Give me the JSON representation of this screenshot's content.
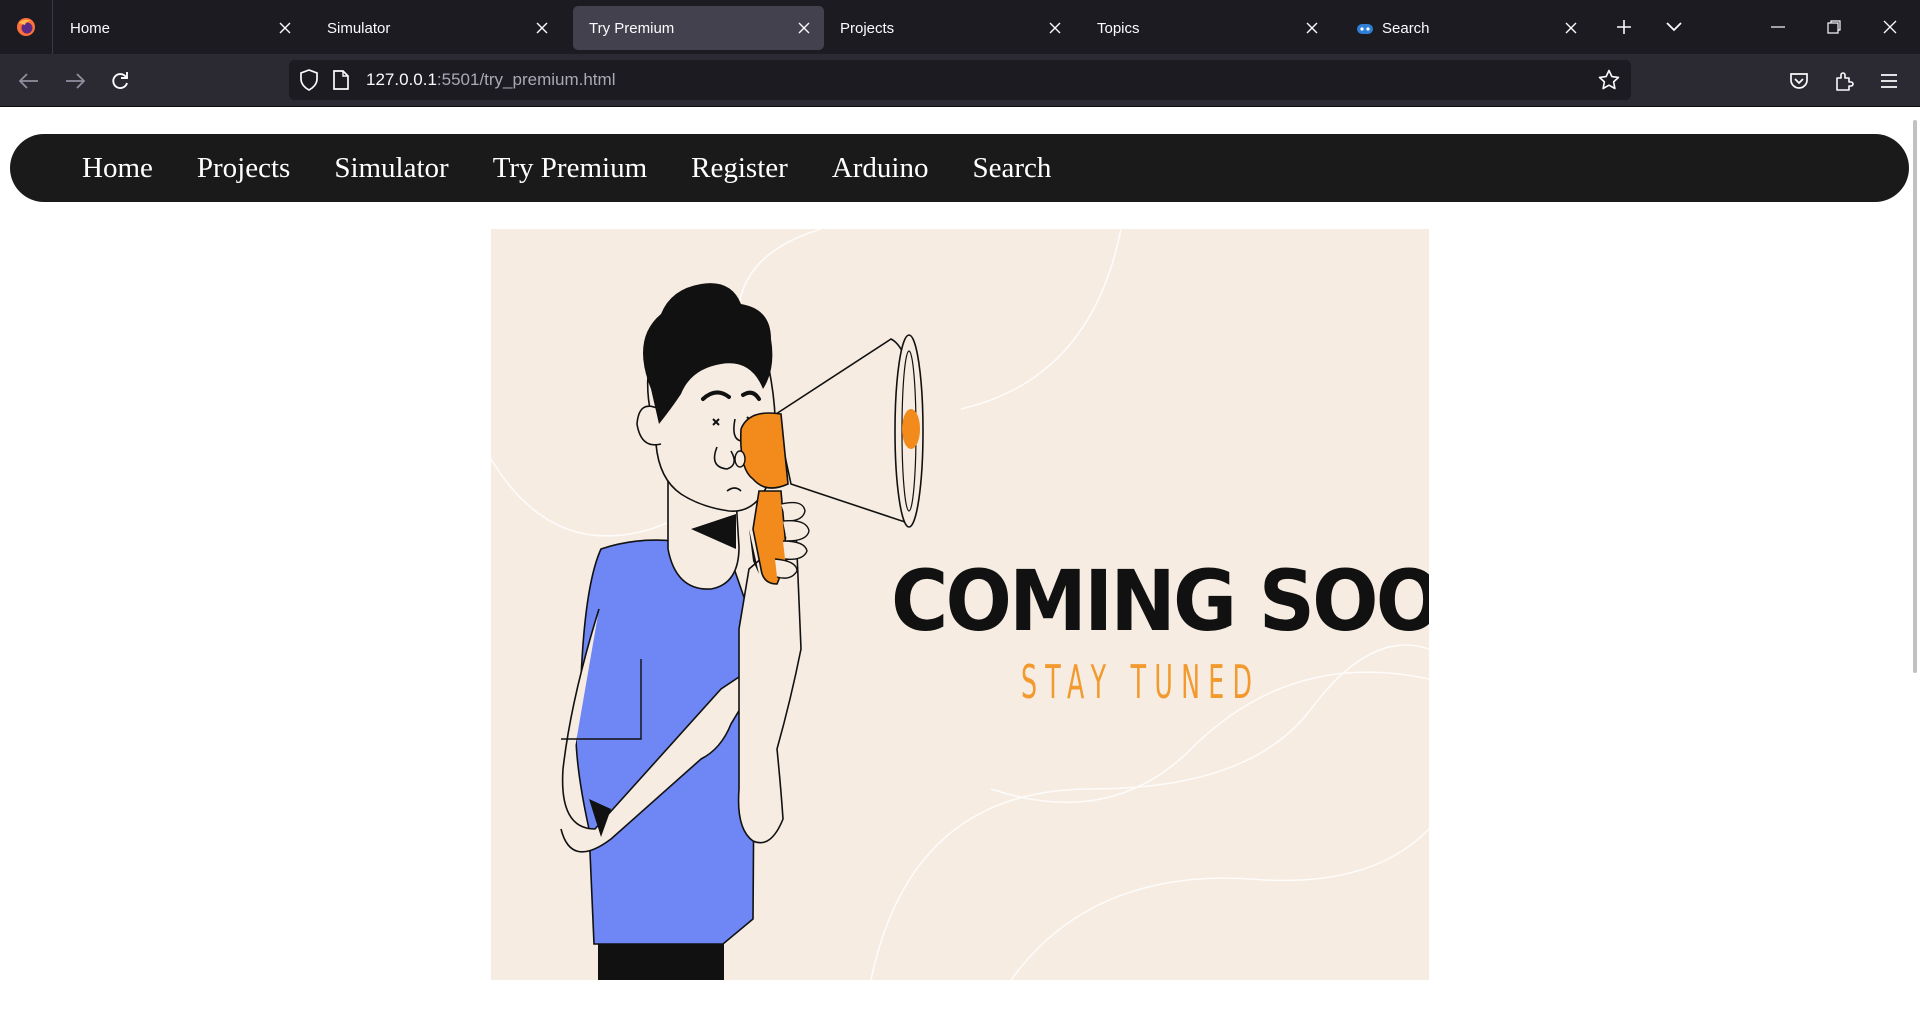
{
  "browser": {
    "tabs": [
      {
        "title": "Home",
        "active": false
      },
      {
        "title": "Simulator",
        "active": false
      },
      {
        "title": "Try Premium",
        "active": true
      },
      {
        "title": "Projects",
        "active": false
      },
      {
        "title": "Topics",
        "active": false
      },
      {
        "title": "Search",
        "active": false
      }
    ],
    "url_host": "127.0.0.1",
    "url_rest": ":5501/try_premium.html"
  },
  "nav": {
    "items": [
      "Home",
      "Projects",
      "Simulator",
      "Try Premium",
      "Register",
      "Arduino",
      "Search"
    ]
  },
  "hero": {
    "headline": "COMING SOON",
    "subline": "STAY TUNED",
    "colors": {
      "background": "#f6ece2",
      "shirt": "#6f86f5",
      "accent": "#f28a1c",
      "ink": "#111111"
    }
  },
  "colors": {
    "tabbar": "#1c1b22",
    "toolbar": "#2b2a33",
    "site_nav": "#1a1a1a"
  }
}
